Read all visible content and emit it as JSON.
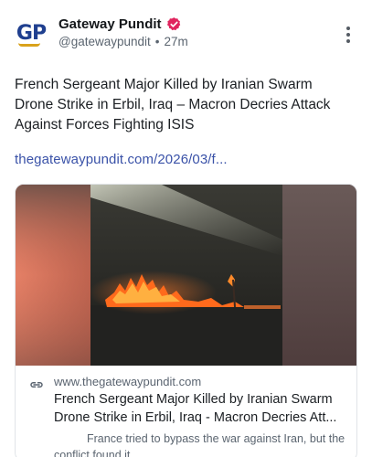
{
  "author": {
    "avatar_text": "GP",
    "name": "Gateway Pundit",
    "handle": "@gatewaypundit",
    "separator": "•",
    "time": "27m",
    "verified_icon": "verified-badge-icon",
    "verified_color": "#e0245e"
  },
  "post": {
    "text": "French Sergeant Major Killed by Iranian Swarm Drone Strike in Erbil, Iraq – Macron Decries Attack Against Forces Fighting ISIS",
    "link": "thegatewaypundit.com/2026/03/f..."
  },
  "card": {
    "domain": "www.thegatewaypundit.com",
    "title": "French Sergeant Major Killed by Iranian Swarm Drone Strike in Erbil, Iraq - Macron Decries Att...",
    "description": "France tried to bypass the war against Iran, but the conflict found it."
  },
  "colors": {
    "link": "#3a52a8",
    "brand_blue": "#1f3f8f",
    "brand_gold": "#d9a21b"
  }
}
